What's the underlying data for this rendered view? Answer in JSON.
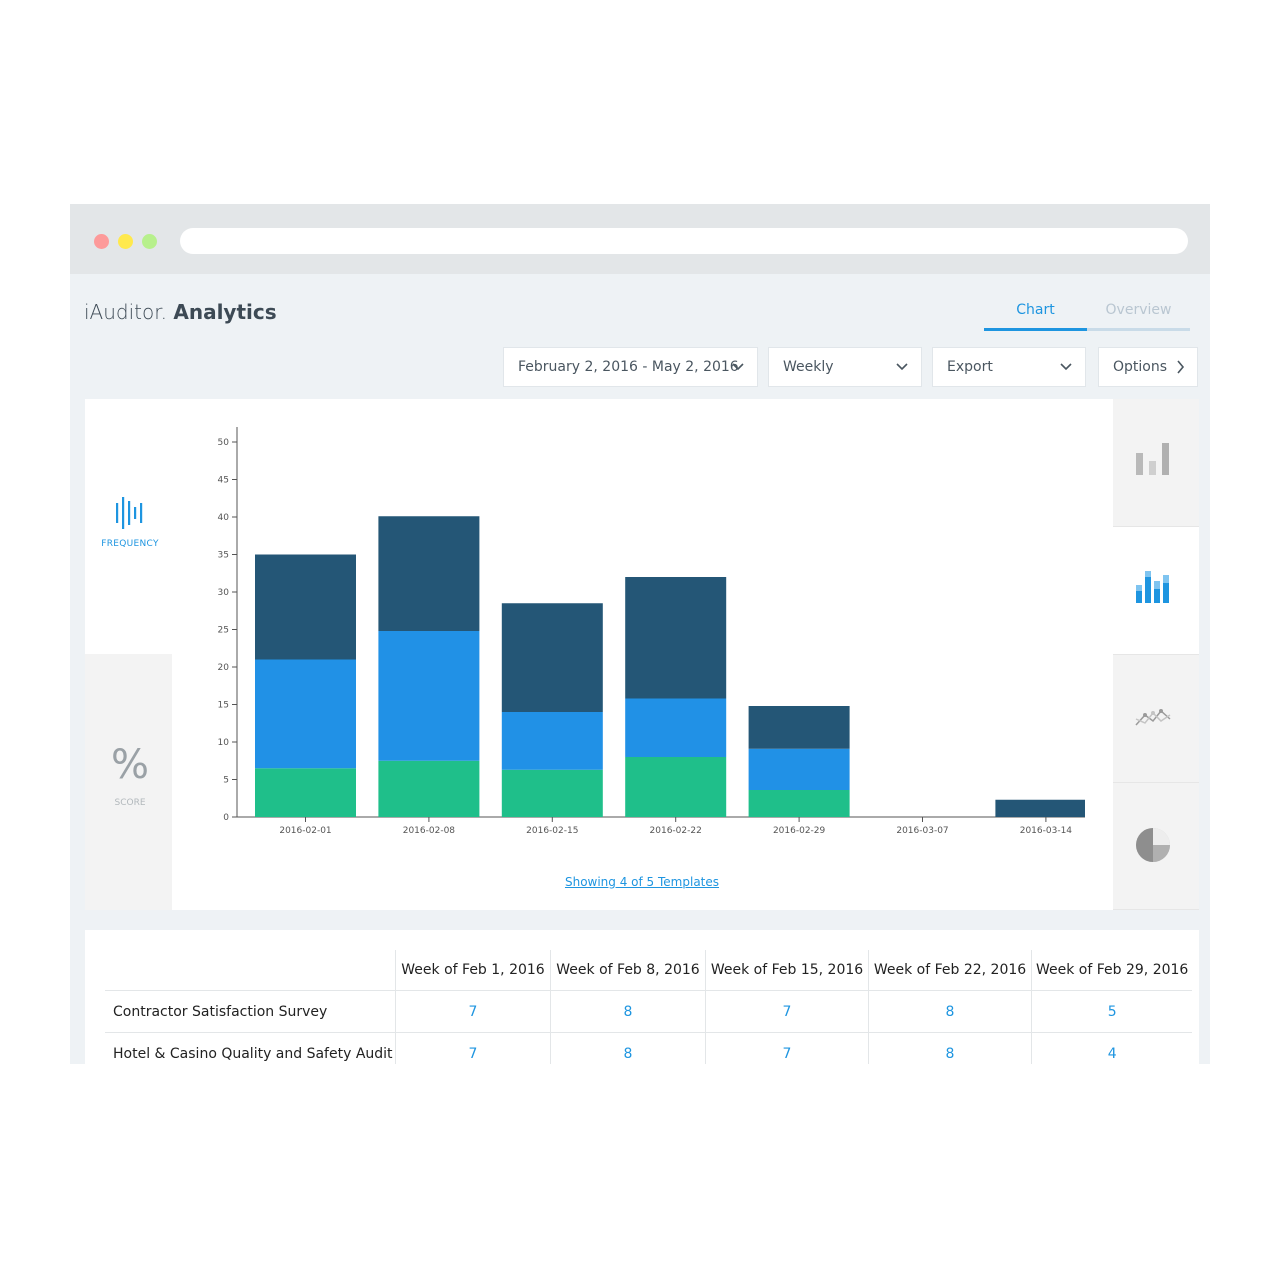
{
  "app": {
    "brand_light": "iAuditor.",
    "brand_bold": "Analytics"
  },
  "tabs": [
    {
      "label": "Chart",
      "active": true
    },
    {
      "label": "Overview",
      "active": false
    }
  ],
  "filters": {
    "date_range": "February 2, 2016 - May 2, 2016",
    "frequency": "Weekly",
    "export": "Export",
    "options": "Options"
  },
  "left_panel": {
    "frequency_label": "FREQUENCY",
    "score_symbol": "%",
    "score_label": "SCORE"
  },
  "chart_footer": "Showing 4 of 5 Templates",
  "colors": {
    "accent": "#1e95e0",
    "series_dark": "#245676",
    "series_blue": "#2191e6",
    "series_green": "#1fbf8a"
  },
  "chart_data": {
    "type": "bar",
    "stacked": true,
    "categories": [
      "2016-02-01",
      "2016-02-08",
      "2016-02-15",
      "2016-02-22",
      "2016-02-29",
      "2016-03-07",
      "2016-03-14"
    ],
    "series": [
      {
        "values": [
          6.5,
          7.5,
          6.3,
          8,
          3.6,
          0,
          0
        ]
      },
      {
        "values": [
          14.5,
          17.3,
          7.7,
          7.8,
          5.5,
          0,
          0
        ]
      },
      {
        "values": [
          14,
          15.3,
          14.5,
          16.2,
          5.7,
          0,
          2.3
        ]
      }
    ],
    "yticks": [
      "0",
      "5",
      "10",
      "15",
      "20",
      "25",
      "30",
      "35",
      "40",
      "45",
      "50"
    ],
    "ylim": [
      0,
      52
    ],
    "xlabel": "",
    "ylabel": "",
    "grid": false
  },
  "table": {
    "columns": [
      "Week of Feb 1, 2016",
      "Week of Feb 8, 2016",
      "Week of Feb 15, 2016",
      "Week of Feb 22, 2016",
      "Week of Feb 29, 2016"
    ],
    "rows": [
      {
        "name": "Contractor Satisfaction Survey",
        "values": [
          "7",
          "8",
          "7",
          "8",
          "5"
        ]
      },
      {
        "name": "Hotel & Casino Quality and Safety Audit",
        "values": [
          "7",
          "8",
          "7",
          "8",
          "4"
        ]
      }
    ]
  }
}
